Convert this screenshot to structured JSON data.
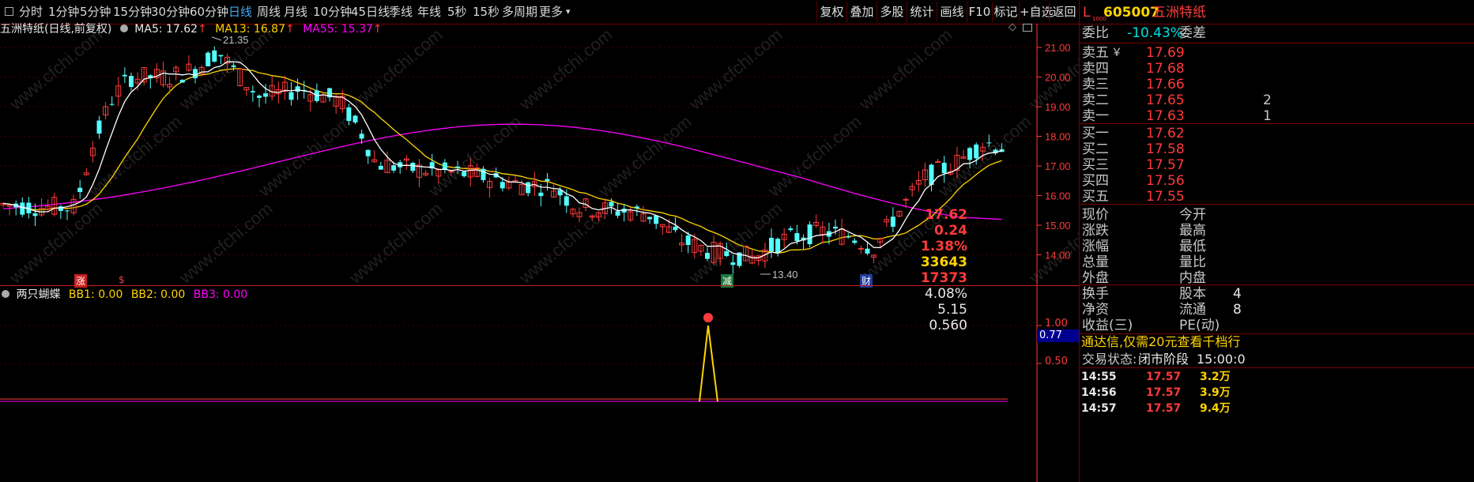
{
  "toolbar": {
    "periods": [
      "分时",
      "1分钟",
      "5分钟",
      "15分钟",
      "30分钟",
      "60分钟",
      "日线",
      "周线",
      "月线",
      "10分钟",
      "45日线",
      "季线",
      "年线",
      "5秒",
      "15秒",
      "多周期",
      "更多"
    ],
    "selected_period": "日线",
    "more_arrow": "▾",
    "buttons": [
      "复权",
      "叠加",
      "多股",
      "统计",
      "画线",
      "F10",
      "标记",
      "+自选",
      "返回"
    ]
  },
  "main_chart": {
    "header": "五洲特纸(日线,前复权)",
    "ma5": "MA5: 17.62",
    "ma13": "MA13: 16.87",
    "ma55": "MA55: 15.37",
    "up_arrow": "↑",
    "high_label": "21.35",
    "low_label": "13.40",
    "markers": [
      {
        "text": "涨",
        "bg": "#c81e1e"
      },
      {
        "text": "$",
        "bg": "#000000"
      },
      {
        "text": "减",
        "bg": "#1e7a3c"
      },
      {
        "text": "财",
        "bg": "#1e3c9a"
      }
    ],
    "y_ticks": [
      "21.00",
      "20.00",
      "19.00",
      "18.00",
      "17.00",
      "16.00",
      "15.00",
      "14.00"
    ],
    "colors": {
      "up": "#ff3b3b",
      "down": "#54ffff",
      "ma5": "#ffffff",
      "ma13": "#ffd400",
      "ma55": "#ff00ff",
      "axis": "#ff3b3b",
      "grid": "#4a0000"
    },
    "watermark": "www.cfchi.com"
  },
  "indicator": {
    "name": "两只蝴蝶",
    "bb1": "BB1: 0.00",
    "bb2": "BB2: 0.00",
    "bb3": "BB3: 0.00",
    "y_ticks": [
      "1.00",
      "0.50"
    ],
    "cursor_value": "0.77"
  },
  "quote": {
    "flag": "L",
    "flag_sub": "1000",
    "code": "605007",
    "name": "五洲特纸",
    "weibi_label": "委比",
    "weibi": "-10.43%",
    "weicha_label": "委差",
    "asks": [
      {
        "label": "卖五",
        "price": "17.69",
        "extra": "￥"
      },
      {
        "label": "卖四",
        "price": "17.68"
      },
      {
        "label": "卖三",
        "price": "17.66"
      },
      {
        "label": "卖二",
        "price": "17.65",
        "vol": "2"
      },
      {
        "label": "卖一",
        "price": "17.63",
        "vol": "1"
      }
    ],
    "bids": [
      {
        "label": "买一",
        "price": "17.62"
      },
      {
        "label": "买二",
        "price": "17.58"
      },
      {
        "label": "买三",
        "price": "17.57"
      },
      {
        "label": "买四",
        "price": "17.56"
      },
      {
        "label": "买五",
        "price": "17.55"
      }
    ],
    "stats": [
      {
        "l": "现价",
        "v": "17.62",
        "c": "red",
        "l2": "今开"
      },
      {
        "l": "涨跌",
        "v": "0.24",
        "c": "red",
        "l2": "最高"
      },
      {
        "l": "涨幅",
        "v": "1.38%",
        "c": "red",
        "l2": "最低"
      },
      {
        "l": "总量",
        "v": "33643",
        "c": "yellow",
        "l2": "量比"
      },
      {
        "l": "外盘",
        "v": "17373",
        "c": "red",
        "l2": "内盘"
      }
    ],
    "stats2": [
      {
        "l": "换手",
        "v": "4.08%",
        "l2": "股本",
        "v2": "4"
      },
      {
        "l": "净资",
        "v": "5.15",
        "l2": "流通",
        "v2": "8"
      },
      {
        "l": "收益(三)",
        "v": "0.560",
        "l2": "PE(动)"
      }
    ],
    "ad_text": "通达信,仅需20元查看千档行",
    "status_label": "交易状态:",
    "status_value": "闭市阶段",
    "status_time": "15:00:0",
    "ticks": [
      {
        "t": "14:55",
        "p": "17.57",
        "v": "3.2万"
      },
      {
        "t": "14:56",
        "p": "17.57",
        "v": "3.9万"
      },
      {
        "t": "14:57",
        "p": "17.57",
        "v": "9.4万"
      }
    ]
  }
}
